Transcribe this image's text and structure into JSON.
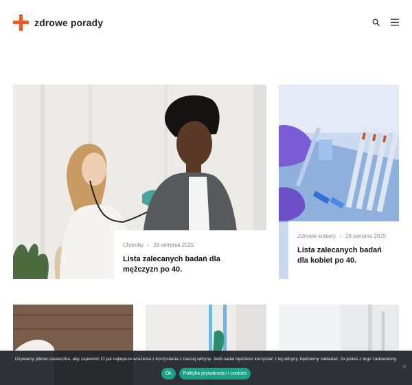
{
  "header": {
    "logo_text": "zdrowe porady",
    "icons": [
      "search-icon",
      "menu-icon"
    ]
  },
  "cards": [
    {
      "category": "Choroby",
      "date": "28 sierpnia 2025",
      "title": "Lista zalecanych badań dla mężczyzn po 40."
    },
    {
      "category": "Zdrowie kobiety",
      "date": "28 sierpnia 2025",
      "title": "Lista zalecanych badań dla kobiet po 40."
    }
  ],
  "cookie": {
    "text": "Używamy plików ciasteczka, aby zapewnić Ci jak najlepsze wrażenia z korzystania z naszej witryny. Jeśli nadal będziesz korzystać z tej witryny, będziemy zakładać, że jesteś z tego zadowolony.",
    "ok_label": "Ok",
    "privacy_label": "Polityka prywatności i cookies",
    "close_symbol": "×"
  },
  "colors": {
    "brand": "#ea5a2c",
    "cookie_bg": "#22262c",
    "cookie_button": "#19a187"
  }
}
